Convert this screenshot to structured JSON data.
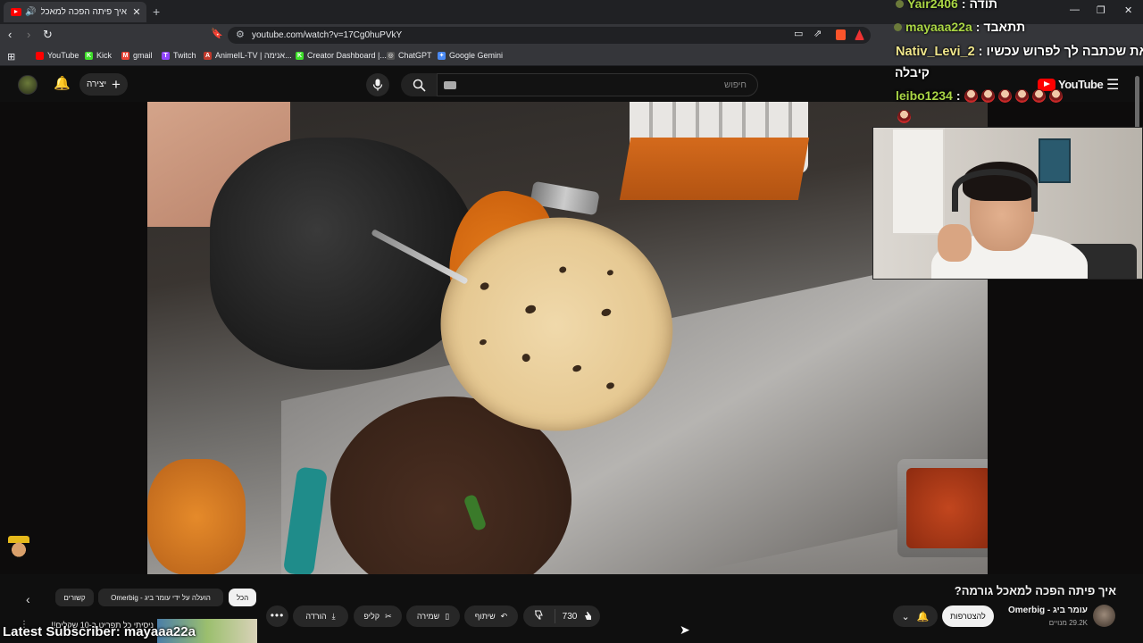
{
  "browser": {
    "tab_title": "איך פיתה הפכה למאכל גורמה?",
    "tab_close": "✕",
    "new_tab": "+",
    "speaker": "🔊",
    "url": "youtube.com/watch?v=17Cg0huPVkY",
    "window_controls": [
      "—",
      "❐",
      "✕"
    ],
    "bookmarks": [
      {
        "label": "YouTube",
        "icon_color": "#ff0000",
        "glyph": "▶"
      },
      {
        "label": "Kick",
        "icon_color": "#3ee02a",
        "glyph": "K"
      },
      {
        "label": "gmail",
        "icon_color": "#ea4335",
        "glyph": "M"
      },
      {
        "label": "Twitch",
        "icon_color": "#9146ff",
        "glyph": "T"
      },
      {
        "label": "AnimeIL-TV | אנימה...",
        "icon_color": "#c0392b",
        "glyph": "A"
      },
      {
        "label": "Creator Dashboard |...",
        "icon_color": "#3ee02a",
        "glyph": "K"
      },
      {
        "label": "ChatGPT",
        "icon_color": "#444444",
        "glyph": "◎"
      },
      {
        "label": "Google Gemini",
        "icon_color": "#4a8af4",
        "glyph": "✦"
      }
    ]
  },
  "youtube": {
    "search_placeholder": "חיפוש",
    "create_label": "יצירה",
    "logo_text": "YouTube",
    "video_title": "איך פיתה הפכה למאכל גורמה?",
    "channel_name": "עומר ביג - Omerbig",
    "subscribers": "29.2K מנויים",
    "join_label": "להצטרפות",
    "like_count": "730",
    "share_label": "שיתוף",
    "save_label": "שמירה",
    "clip_label": "קליפ",
    "download_label": "הורדה",
    "more_label": "•••",
    "chips": [
      {
        "label": "הכל",
        "active": true
      },
      {
        "label": "הועלה על ידי עומר ביג - Omerbig",
        "active": false
      },
      {
        "label": "קשורים",
        "active": false
      }
    ],
    "rec_title": "ניסיתי כל תפריט ב-10 שקלים!!!"
  },
  "stream_overlay": {
    "chat": [
      {
        "user": "Yair2406",
        "msg": "תודה"
      },
      {
        "user": "mayaaa22a",
        "msg": "תתאבד"
      },
      {
        "user": "Nativ_Levi_2",
        "msg": "זאת שכתבה לך לפרוש עכשיו"
      },
      {
        "user": "",
        "msg": "קיבלה"
      },
      {
        "user": "leibo1234",
        "msg": ""
      }
    ],
    "latest_subscriber": "Latest Subscriber: mayaaa22a"
  },
  "colors": {
    "bg": "#0f0f0f",
    "accent": "#ff0000",
    "chat_user": "#aad645"
  }
}
